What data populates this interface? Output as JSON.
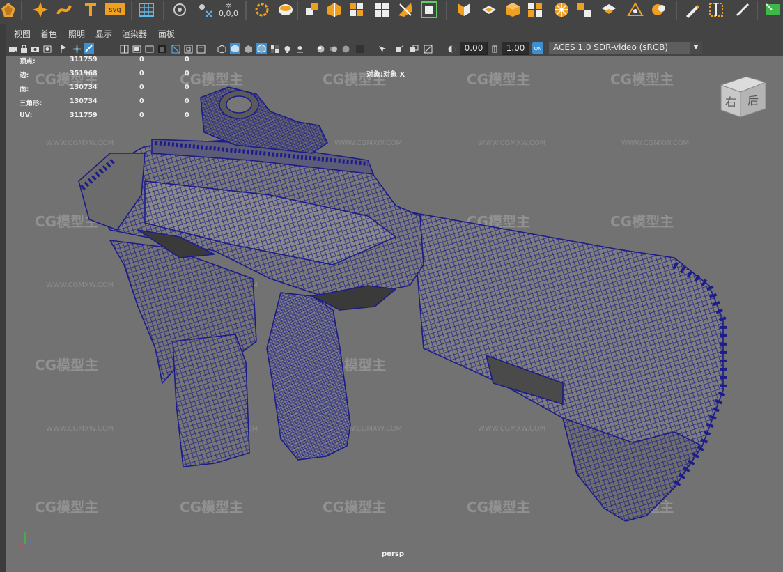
{
  "shelf": {
    "icons": [
      "app-logo-icon",
      "sparkle-tool-icon",
      "curve-tool-icon",
      "type-tool-icon",
      "svg-tool-icon",
      "grid-tool-icon",
      "lattice-tool-icon",
      "snap-points-icon",
      "transform-coords-icon",
      "lasso-circle-icon",
      "bevel-icon",
      "extrude-icon",
      "polygon-split-icon",
      "merge-icon",
      "extract-icon",
      "combine-icon",
      "separate-icon",
      "mirror-icon",
      "bridge-icon",
      "multi-cut-icon",
      "fill-hole-icon",
      "cube-icon",
      "uv-layout-icon",
      "sphere-icon",
      "plane-icon",
      "cone-icon",
      "pen-icon",
      "measure-icon",
      "slash-tool-icon",
      "cube-green-icon"
    ],
    "svg_label": "svg",
    "coords_label": "0,0,0"
  },
  "panel_menu": {
    "items": [
      "视图",
      "着色",
      "照明",
      "显示",
      "渲染器",
      "面板"
    ]
  },
  "panel_toolbar": {
    "exposure_value": "0.00",
    "gamma_value": "1.00",
    "color_transform": "ACES 1.0 SDR-video (sRGB)"
  },
  "hud": {
    "rows": [
      {
        "label": "顶点:",
        "v1": "311759",
        "v2": "0",
        "v3": "0"
      },
      {
        "label": "边:",
        "v1": "351968",
        "v2": "0",
        "v3": "0"
      },
      {
        "label": "面:",
        "v1": "130734",
        "v2": "0",
        "v3": "0"
      },
      {
        "label": "三角形:",
        "v1": "130734",
        "v2": "0",
        "v3": "0"
      },
      {
        "label": "UV:",
        "v1": "311759",
        "v2": "0",
        "v3": "0"
      }
    ],
    "object_label": "对象:对象 X",
    "camera": "persp"
  },
  "viewcube": {
    "face_right": "右",
    "face_back": "后"
  },
  "watermark": {
    "brand": "CG模型主",
    "url": "WWW.CGMXW.COM"
  },
  "colors": {
    "viewport_bg": "#727272",
    "wire": "#1c1c8a",
    "mesh_fill": "#7a7a7a"
  }
}
